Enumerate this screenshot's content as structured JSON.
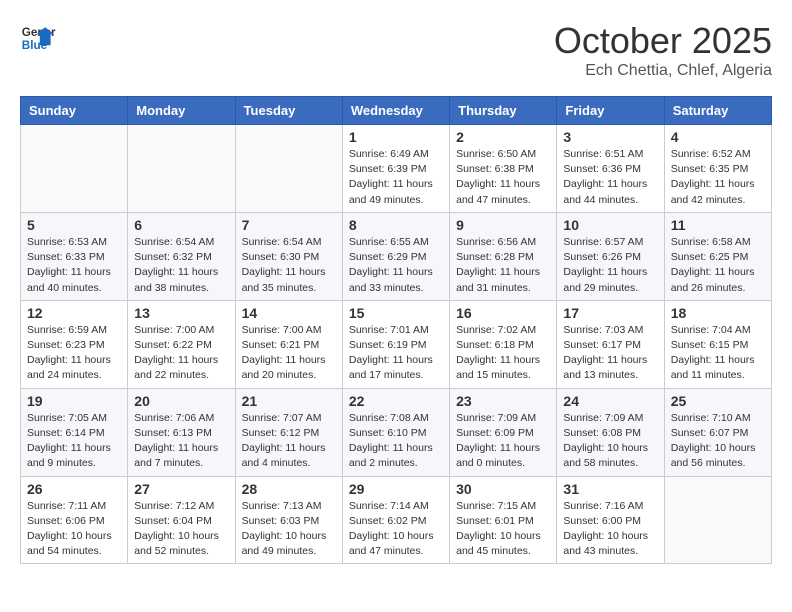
{
  "header": {
    "logo_line1": "General",
    "logo_line2": "Blue",
    "month": "October 2025",
    "location": "Ech Chettia, Chlef, Algeria"
  },
  "weekdays": [
    "Sunday",
    "Monday",
    "Tuesday",
    "Wednesday",
    "Thursday",
    "Friday",
    "Saturday"
  ],
  "weeks": [
    [
      {
        "day": "",
        "info": ""
      },
      {
        "day": "",
        "info": ""
      },
      {
        "day": "",
        "info": ""
      },
      {
        "day": "1",
        "info": "Sunrise: 6:49 AM\nSunset: 6:39 PM\nDaylight: 11 hours\nand 49 minutes."
      },
      {
        "day": "2",
        "info": "Sunrise: 6:50 AM\nSunset: 6:38 PM\nDaylight: 11 hours\nand 47 minutes."
      },
      {
        "day": "3",
        "info": "Sunrise: 6:51 AM\nSunset: 6:36 PM\nDaylight: 11 hours\nand 44 minutes."
      },
      {
        "day": "4",
        "info": "Sunrise: 6:52 AM\nSunset: 6:35 PM\nDaylight: 11 hours\nand 42 minutes."
      }
    ],
    [
      {
        "day": "5",
        "info": "Sunrise: 6:53 AM\nSunset: 6:33 PM\nDaylight: 11 hours\nand 40 minutes."
      },
      {
        "day": "6",
        "info": "Sunrise: 6:54 AM\nSunset: 6:32 PM\nDaylight: 11 hours\nand 38 minutes."
      },
      {
        "day": "7",
        "info": "Sunrise: 6:54 AM\nSunset: 6:30 PM\nDaylight: 11 hours\nand 35 minutes."
      },
      {
        "day": "8",
        "info": "Sunrise: 6:55 AM\nSunset: 6:29 PM\nDaylight: 11 hours\nand 33 minutes."
      },
      {
        "day": "9",
        "info": "Sunrise: 6:56 AM\nSunset: 6:28 PM\nDaylight: 11 hours\nand 31 minutes."
      },
      {
        "day": "10",
        "info": "Sunrise: 6:57 AM\nSunset: 6:26 PM\nDaylight: 11 hours\nand 29 minutes."
      },
      {
        "day": "11",
        "info": "Sunrise: 6:58 AM\nSunset: 6:25 PM\nDaylight: 11 hours\nand 26 minutes."
      }
    ],
    [
      {
        "day": "12",
        "info": "Sunrise: 6:59 AM\nSunset: 6:23 PM\nDaylight: 11 hours\nand 24 minutes."
      },
      {
        "day": "13",
        "info": "Sunrise: 7:00 AM\nSunset: 6:22 PM\nDaylight: 11 hours\nand 22 minutes."
      },
      {
        "day": "14",
        "info": "Sunrise: 7:00 AM\nSunset: 6:21 PM\nDaylight: 11 hours\nand 20 minutes."
      },
      {
        "day": "15",
        "info": "Sunrise: 7:01 AM\nSunset: 6:19 PM\nDaylight: 11 hours\nand 17 minutes."
      },
      {
        "day": "16",
        "info": "Sunrise: 7:02 AM\nSunset: 6:18 PM\nDaylight: 11 hours\nand 15 minutes."
      },
      {
        "day": "17",
        "info": "Sunrise: 7:03 AM\nSunset: 6:17 PM\nDaylight: 11 hours\nand 13 minutes."
      },
      {
        "day": "18",
        "info": "Sunrise: 7:04 AM\nSunset: 6:15 PM\nDaylight: 11 hours\nand 11 minutes."
      }
    ],
    [
      {
        "day": "19",
        "info": "Sunrise: 7:05 AM\nSunset: 6:14 PM\nDaylight: 11 hours\nand 9 minutes."
      },
      {
        "day": "20",
        "info": "Sunrise: 7:06 AM\nSunset: 6:13 PM\nDaylight: 11 hours\nand 7 minutes."
      },
      {
        "day": "21",
        "info": "Sunrise: 7:07 AM\nSunset: 6:12 PM\nDaylight: 11 hours\nand 4 minutes."
      },
      {
        "day": "22",
        "info": "Sunrise: 7:08 AM\nSunset: 6:10 PM\nDaylight: 11 hours\nand 2 minutes."
      },
      {
        "day": "23",
        "info": "Sunrise: 7:09 AM\nSunset: 6:09 PM\nDaylight: 11 hours\nand 0 minutes."
      },
      {
        "day": "24",
        "info": "Sunrise: 7:09 AM\nSunset: 6:08 PM\nDaylight: 10 hours\nand 58 minutes."
      },
      {
        "day": "25",
        "info": "Sunrise: 7:10 AM\nSunset: 6:07 PM\nDaylight: 10 hours\nand 56 minutes."
      }
    ],
    [
      {
        "day": "26",
        "info": "Sunrise: 7:11 AM\nSunset: 6:06 PM\nDaylight: 10 hours\nand 54 minutes."
      },
      {
        "day": "27",
        "info": "Sunrise: 7:12 AM\nSunset: 6:04 PM\nDaylight: 10 hours\nand 52 minutes."
      },
      {
        "day": "28",
        "info": "Sunrise: 7:13 AM\nSunset: 6:03 PM\nDaylight: 10 hours\nand 49 minutes."
      },
      {
        "day": "29",
        "info": "Sunrise: 7:14 AM\nSunset: 6:02 PM\nDaylight: 10 hours\nand 47 minutes."
      },
      {
        "day": "30",
        "info": "Sunrise: 7:15 AM\nSunset: 6:01 PM\nDaylight: 10 hours\nand 45 minutes."
      },
      {
        "day": "31",
        "info": "Sunrise: 7:16 AM\nSunset: 6:00 PM\nDaylight: 10 hours\nand 43 minutes."
      },
      {
        "day": "",
        "info": ""
      }
    ]
  ]
}
